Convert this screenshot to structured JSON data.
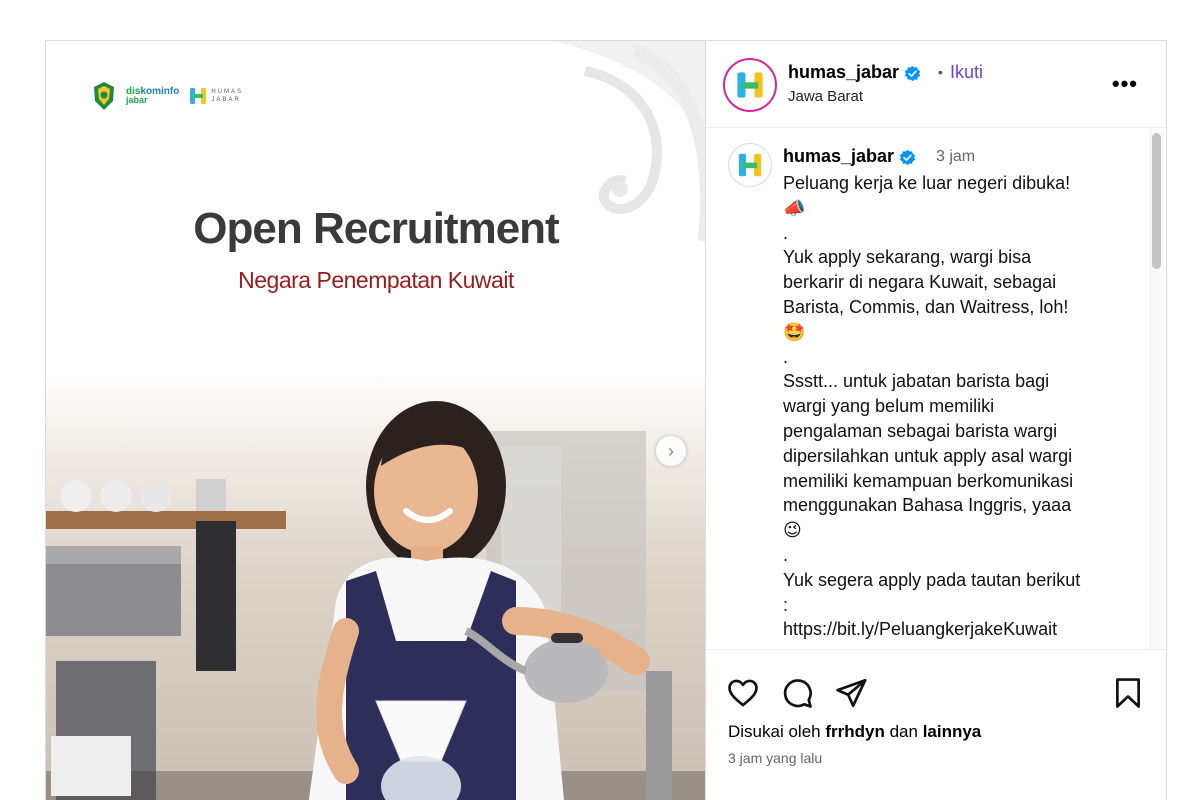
{
  "media": {
    "logos": {
      "diskominfo_top_a": "dis",
      "diskominfo_top_b": "kominfo",
      "diskominfo_bottom": "jabar",
      "humas_text": "HUMAS\nJABAR"
    },
    "headline": "Open Recruitment",
    "subheadline": "Negara Penempatan Kuwait",
    "next_icon": "chevron-right-icon"
  },
  "header": {
    "username": "humas_jabar",
    "separator": "•",
    "follow_label": "Ikuti",
    "location": "Jawa Barat",
    "more_label": "•••"
  },
  "caption": {
    "username": "humas_jabar",
    "time": "3 jam",
    "text": "Peluang kerja ke luar negeri dibuka!\n📣\n.\nYuk apply sekarang, wargi bisa\nberkarir di negara Kuwait, sebagai\nBarista, Commis, dan Waitress, loh!\n🤩\n.\nSsstt... untuk jabatan barista bagi\nwargi yang belum memiliki\npengalaman sebagai barista wargi\ndipersilahkan untuk apply asal wargi\nmemiliki kemampuan berkomunikasi\nmenggunakan Bahasa Inggris, yaaa\n😉\n.\nYuk segera apply pada tautan berikut\n:\nhttps://bit.ly/PeluangkerjakeKuwait"
  },
  "actions": {
    "icons": [
      "heart-icon",
      "comment-icon",
      "share-icon",
      "bookmark-icon"
    ],
    "likes_prefix": "Disukai oleh",
    "likes_user": "frrhdyn",
    "likes_conj": "dan",
    "likes_others": "lainnya",
    "post_time": "3 jam yang lalu"
  },
  "colors": {
    "follow": "#6c3ee8",
    "verified": "#0095f6",
    "headline": "#3a3a3a",
    "subheadline": "#9b1b1b"
  }
}
